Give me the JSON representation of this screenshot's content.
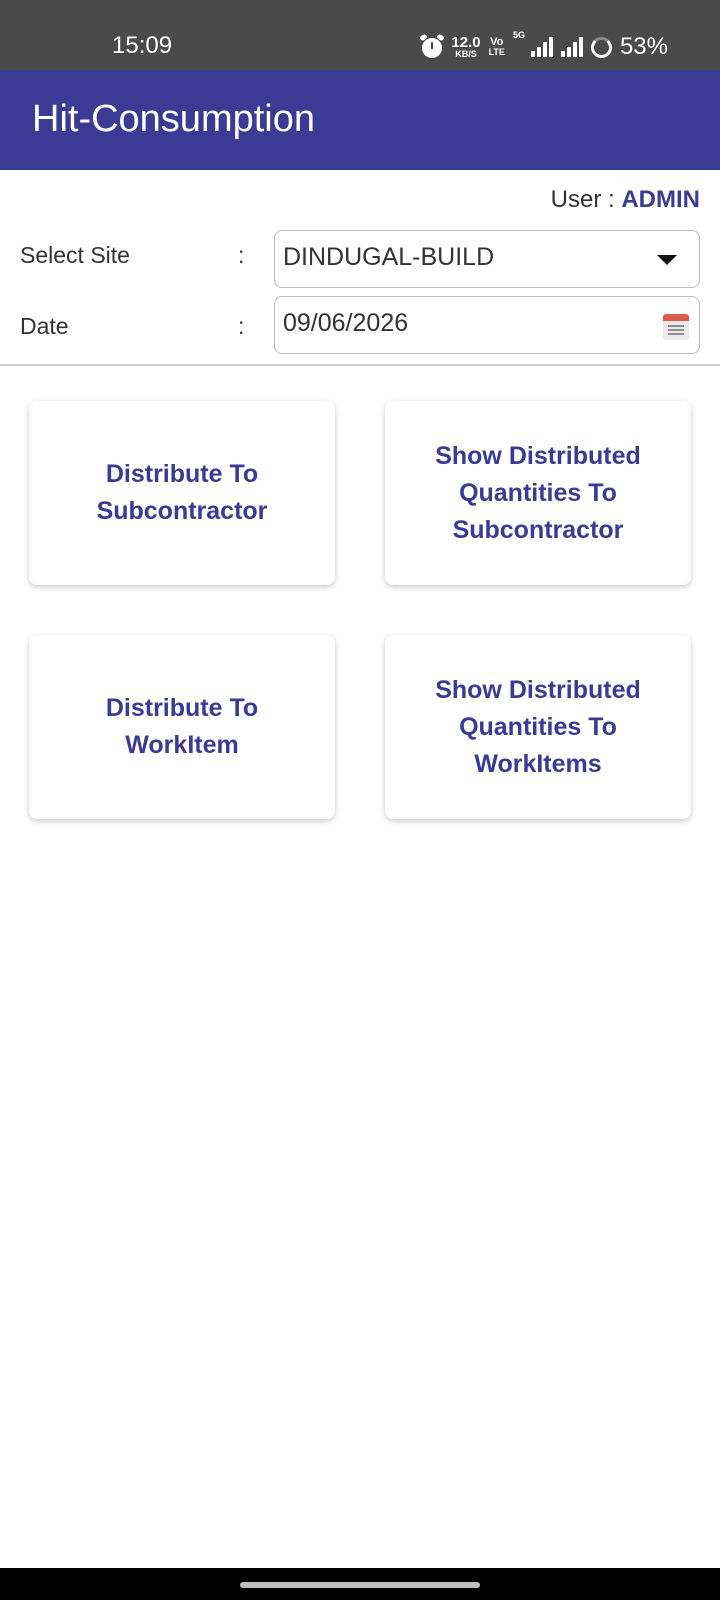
{
  "status_bar": {
    "time": "15:09",
    "net_speed": "12.0",
    "net_unit": "KB/S",
    "volte_top": "Vo",
    "volte_bottom": "LTE",
    "network_type": "5G",
    "battery": "53%"
  },
  "app_bar": {
    "title": "Hit-Consumption",
    "color": "#3b3a94"
  },
  "user": {
    "label": "User : ",
    "name": "ADMIN"
  },
  "form": {
    "site_label": "Select Site",
    "site_value": "DINDUGAL-BUILD",
    "date_label": "Date",
    "date_value": "09/06/2026",
    "separator": ":"
  },
  "cards": [
    {
      "label": "Distribute To Subcontractor"
    },
    {
      "label": "Show Distributed Quantities To Subcontractor"
    },
    {
      "label": "Distribute To WorkItem"
    },
    {
      "label": "Show Distributed Quantities To WorkItems"
    }
  ]
}
